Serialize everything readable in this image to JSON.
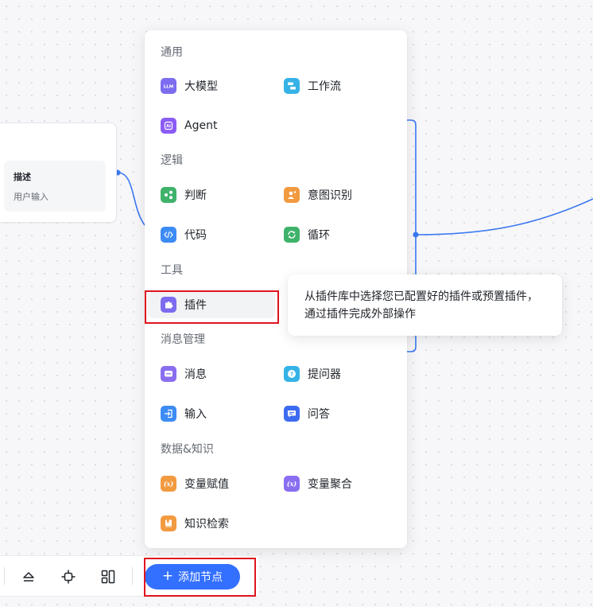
{
  "node": {
    "field_name": "描述",
    "field_value": "用户输入"
  },
  "menu": {
    "sections": [
      {
        "title": "通用",
        "items": [
          {
            "label": "大模型",
            "icon": "llm-icon",
            "color": "#7c6cf0"
          },
          {
            "label": "工作流",
            "icon": "workflow-icon",
            "color": "#36b3e6"
          },
          {
            "label": "Agent",
            "icon": "agent-icon",
            "color": "#8a5cf5"
          }
        ]
      },
      {
        "title": "逻辑",
        "items": [
          {
            "label": "判断",
            "icon": "branch-icon",
            "color": "#3fb26b"
          },
          {
            "label": "意图识别",
            "icon": "intent-icon",
            "color": "#f29a40"
          },
          {
            "label": "代码",
            "icon": "code-icon",
            "color": "#3d8bf5"
          },
          {
            "label": "循环",
            "icon": "loop-icon",
            "color": "#3fb26b"
          }
        ]
      },
      {
        "title": "工具",
        "items": [
          {
            "label": "插件",
            "icon": "plugin-icon",
            "color": "#7c6cf0"
          }
        ]
      },
      {
        "title": "消息管理",
        "items": [
          {
            "label": "消息",
            "icon": "message-icon",
            "color": "#8a6ef0"
          },
          {
            "label": "提问器",
            "icon": "question-icon",
            "color": "#36b3e6"
          },
          {
            "label": "输入",
            "icon": "input-icon",
            "color": "#3d8bf5"
          },
          {
            "label": "问答",
            "icon": "qa-icon",
            "color": "#3d6bf0"
          }
        ]
      },
      {
        "title": "数据&知识",
        "items": [
          {
            "label": "变量赋值",
            "icon": "variable-assign-icon",
            "color": "#f29a40"
          },
          {
            "label": "变量聚合",
            "icon": "variable-aggregate-icon",
            "color": "#8a6ef0"
          },
          {
            "label": "知识检索",
            "icon": "knowledge-icon",
            "color": "#f29a40"
          }
        ]
      }
    ]
  },
  "tooltip": {
    "text": "从插件库中选择您已配置好的插件或预置插件，通过插件完成外部操作"
  },
  "toolbar": {
    "add_node_label": "添加节点",
    "icons": [
      "collapse-icon",
      "locate-icon",
      "layout-icon"
    ]
  },
  "colors": {
    "accent": "#3370ff",
    "edge": "#3a78f2",
    "highlight_box": "#e0141e"
  }
}
